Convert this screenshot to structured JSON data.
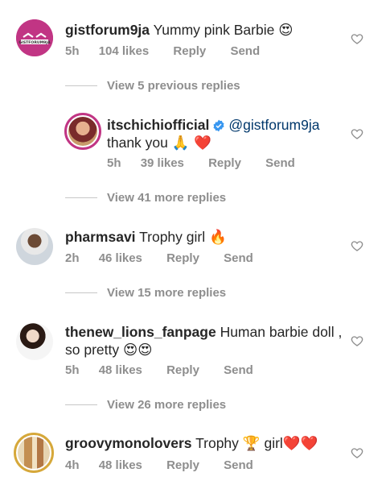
{
  "comments": [
    {
      "username": "gistforum9ja",
      "text": "Yummy pink Barbie",
      "emoji": "😍",
      "time": "5h",
      "likes": "104 likes",
      "reply": "Reply",
      "send": "Send",
      "avatar_text": "GISTFORUM9JA"
    },
    {
      "username": "itschichiofficial",
      "mention": "@gistforum9ja",
      "text": "thank you",
      "emoji": "🙏 ❤️",
      "time": "5h",
      "likes": "39 likes",
      "reply": "Reply",
      "send": "Send"
    },
    {
      "username": "pharmsavi",
      "text": "Trophy girl",
      "emoji": "🔥",
      "time": "2h",
      "likes": "46 likes",
      "reply": "Reply",
      "send": "Send"
    },
    {
      "username": "thenew_lions_fanpage",
      "text": "Human barbie doll ,",
      "text2": "so pretty",
      "emoji": "😍😍",
      "time": "5h",
      "likes": "48 likes",
      "reply": "Reply",
      "send": "Send"
    },
    {
      "username": "groovymonolovers",
      "text": "Trophy",
      "emoji_mid": "🏆",
      "text_after": "girl",
      "emoji": "❤️❤️",
      "time": "4h",
      "likes": "48 likes",
      "reply": "Reply",
      "send": "Send"
    }
  ],
  "view_replies": [
    "View 5 previous replies",
    "View 41 more replies",
    "View 15 more replies",
    "View 26 more replies"
  ],
  "colors": {
    "text": "#262626",
    "meta": "#8e8e8e",
    "mention": "#00376b",
    "verified": "#3897f0",
    "avatar1_bg": "#c13584"
  }
}
